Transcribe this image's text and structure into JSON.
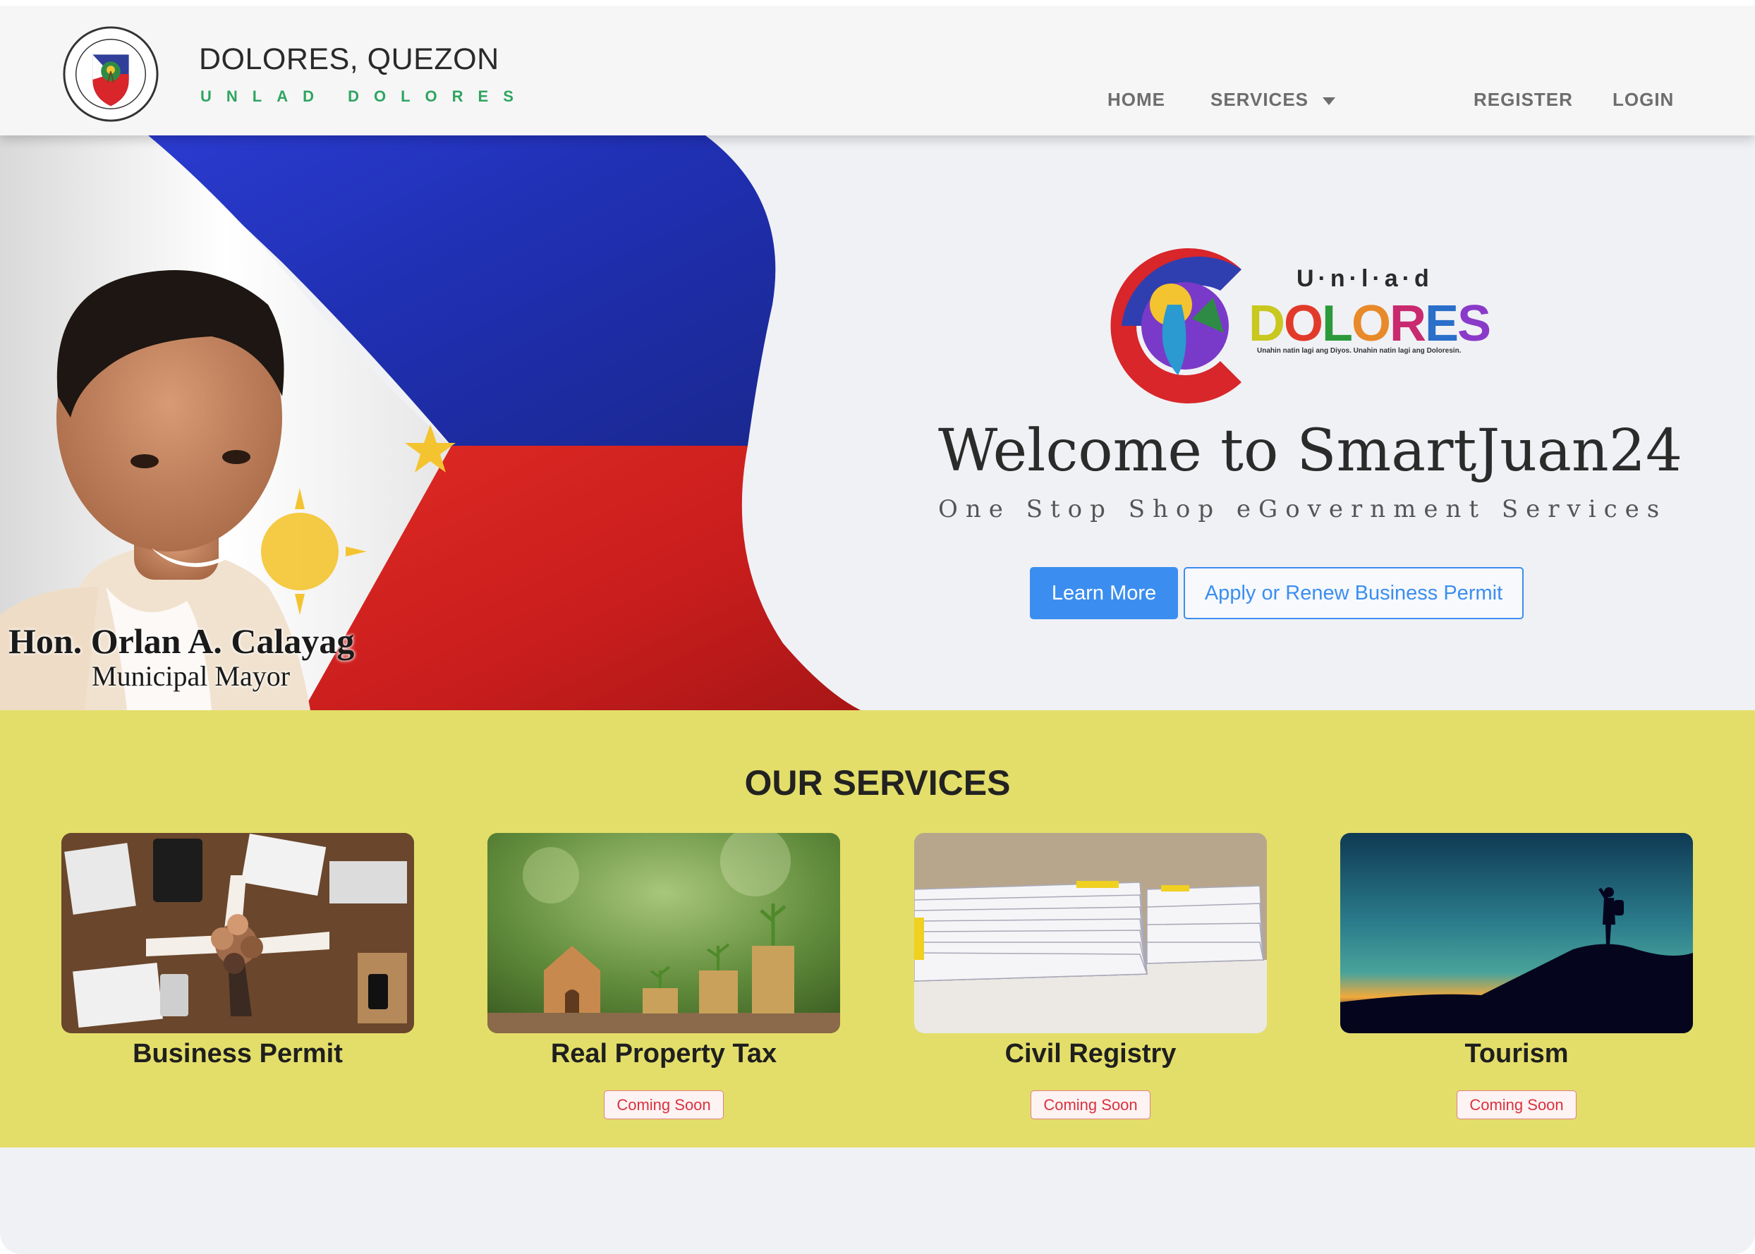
{
  "header": {
    "title": "DOLORES, QUEZON",
    "subtitle": "UNLAD DOLORES",
    "seal_text_top": "BAYAN NG DOLORES",
    "seal_text_bottom": "QUEZON",
    "nav": {
      "home": "HOME",
      "services": "SERVICES",
      "register": "REGISTER",
      "login": "LOGIN"
    }
  },
  "hero": {
    "mayor_name": "Hon. Orlan A. Calayag",
    "mayor_title": "Municipal Mayor",
    "logo": {
      "unlad": "U·n·l·a·d",
      "letters": [
        "D",
        "O",
        "L",
        "O",
        "R",
        "E",
        "S"
      ],
      "letter_colors": [
        "#c8c81e",
        "#e23a2a",
        "#2b9a3a",
        "#e8892a",
        "#c92a6f",
        "#2a6fc9",
        "#8a3ac9"
      ],
      "tagline": "Unahin natin lagi ang Diyos. Unahin natin lagi ang Doloresin."
    },
    "welcome": "Welcome to SmartJuan24",
    "tagline": "One Stop Shop eGovernment Services",
    "learn_more": "Learn More",
    "apply_permit": "Apply or Renew Business Permit"
  },
  "services": {
    "heading": "OUR SERVICES",
    "cards": [
      {
        "title": "Business Permit",
        "badge": ""
      },
      {
        "title": "Real Property Tax",
        "badge": "Coming Soon"
      },
      {
        "title": "Civil Registry",
        "badge": "Coming Soon"
      },
      {
        "title": "Tourism",
        "badge": "Coming Soon"
      }
    ]
  },
  "colors": {
    "accent": "#3b8ef0",
    "services_bg": "#e3de69",
    "brand_green": "#2fa55f",
    "badge_red": "#d9323f"
  }
}
